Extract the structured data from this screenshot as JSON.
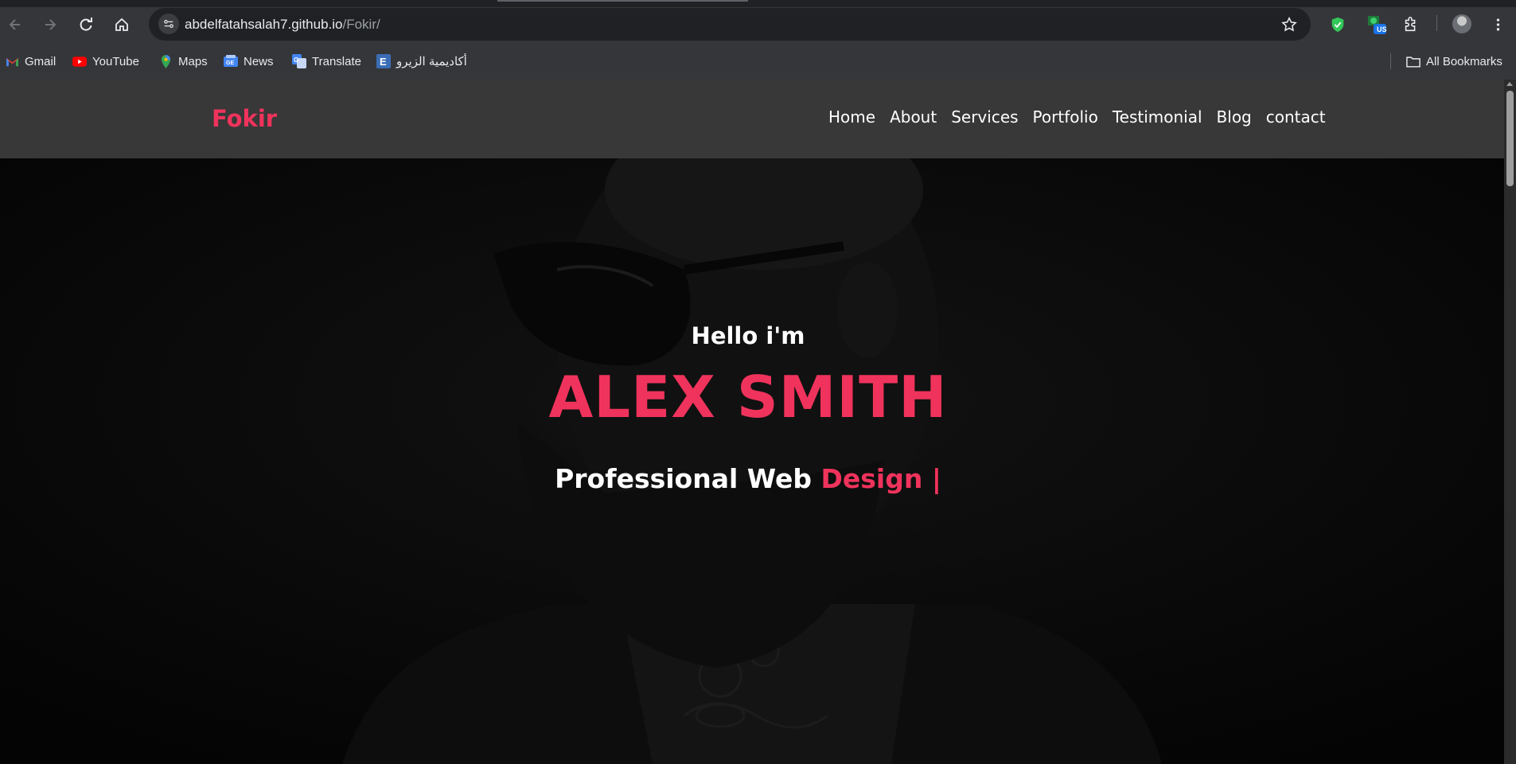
{
  "browser": {
    "url_host": "abdelfatahsalah7.github.io",
    "url_path": "/Fokir/",
    "bookmarks": [
      {
        "label": "Gmail",
        "icon": "gmail-icon"
      },
      {
        "label": "YouTube",
        "icon": "youtube-icon"
      },
      {
        "label": "Maps",
        "icon": "maps-icon"
      },
      {
        "label": "News",
        "icon": "news-icon"
      },
      {
        "label": "Translate",
        "icon": "translate-icon"
      },
      {
        "label": "أكاديمية الزيرو",
        "icon": "e-academy-icon"
      }
    ],
    "all_bookmarks": "All Bookmarks",
    "extension_badge": "US"
  },
  "site": {
    "logo": "Fokir",
    "nav": [
      "Home",
      "About",
      "Services",
      "Portfolio",
      "Testimonial",
      "Blog",
      "contact"
    ],
    "accent_color": "#f0335c"
  },
  "hero": {
    "greeting": "Hello i'm",
    "name": "ALEX SMITH",
    "role_prefix": "Professional Web ",
    "role_highlight": "Design |"
  }
}
